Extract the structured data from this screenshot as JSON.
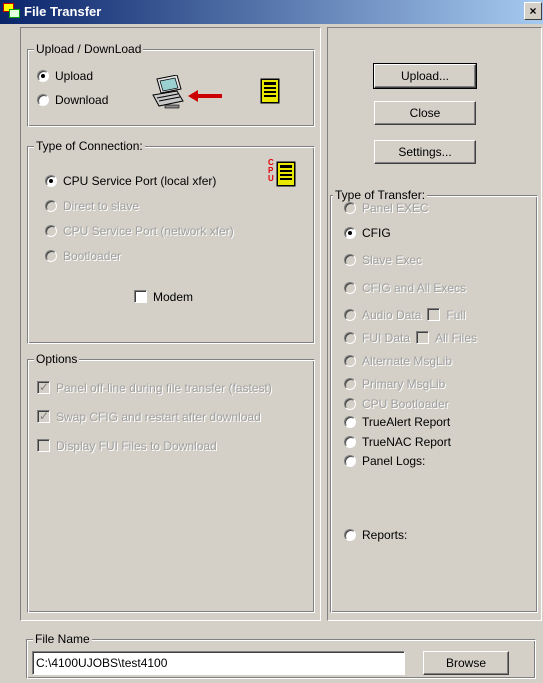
{
  "window": {
    "title": "File Transfer",
    "close_glyph": "×"
  },
  "upload_download": {
    "legend": "Upload / DownLoad",
    "options": [
      "Upload",
      "Download"
    ],
    "selected": "Upload",
    "illustration_icons": [
      "computer-icon",
      "red-arrow-left-icon",
      "panel-device-icon"
    ]
  },
  "connection": {
    "legend": "Type of Connection:",
    "options": [
      "CPU Service Port (local xfer)",
      "Direct to slave",
      "CPU Service Port (network xfer)",
      "Bootloader"
    ],
    "selected": "CPU Service Port (local xfer)",
    "cpu_badge": "CPU",
    "modem_label": "Modem"
  },
  "options": {
    "legend": "Options",
    "items": [
      {
        "label": "Panel off-line during file transfer (fastest)",
        "checked": true
      },
      {
        "label": "Swap CFIG and restart after download",
        "checked": true
      },
      {
        "label": "Display FUI Files to Download",
        "checked": false
      }
    ]
  },
  "buttons": {
    "upload": "Upload...",
    "close": "Close",
    "settings": "Settings...",
    "browse": "Browse"
  },
  "transfer": {
    "legend": "Type of Transfer:",
    "options": [
      "Panel EXEC",
      "CFIG",
      "Slave Exec",
      "CFIG and All Execs",
      "Audio Data",
      "FUI Data",
      "Alternate MsgLib",
      "Primary MsgLib",
      "CPU Bootloader",
      "TrueAlert Report",
      "TrueNAC Report",
      "Panel Logs:",
      "Reports:"
    ],
    "selected": "CFIG",
    "audio_full_label": "Full",
    "fui_all_files_label": "All Files"
  },
  "file_name": {
    "legend": "File Name",
    "value": "C:\\4100UJOBS\\test4100"
  },
  "colors": {
    "title_start": "#0a246a",
    "title_end": "#a6caf0",
    "face": "#d4d0c8",
    "disabled_text": "#a0a0a0"
  }
}
